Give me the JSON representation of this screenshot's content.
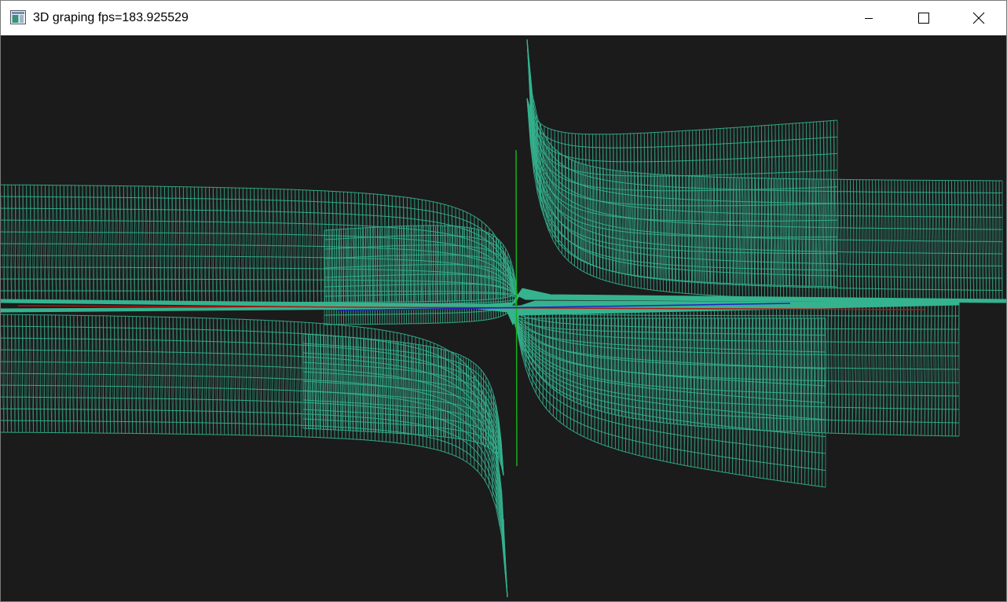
{
  "window": {
    "title": "3D graping fps=183.925529",
    "icon": "application-window-icon",
    "controls": {
      "minimize": "minimize-icon",
      "maximize": "maximize-icon",
      "close": "close-icon"
    }
  },
  "viewport": {
    "background": "#1b1b1b",
    "mesh_color": "#35b38f",
    "axis_colors": {
      "x": "#c01010",
      "y": "#18b018",
      "z": "#2020c8"
    },
    "render_mode": "wireframe"
  }
}
